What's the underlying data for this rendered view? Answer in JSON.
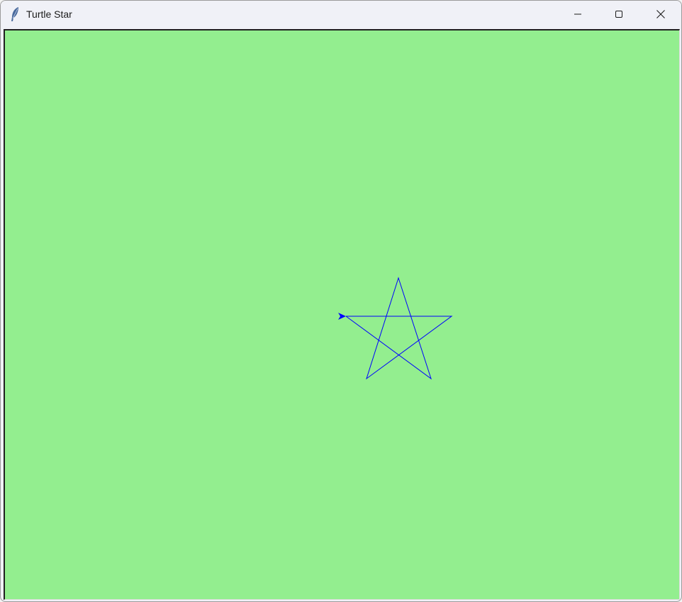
{
  "window": {
    "title": "Turtle Star",
    "app_icon": "feather-icon",
    "controls": [
      "minimize-icon",
      "maximize-icon",
      "close-icon"
    ]
  },
  "canvas": {
    "background_color": "#93ee8f",
    "pen_color": "#0000ff",
    "turtle_color": "#0000ff",
    "shape": "five-pointed-star"
  }
}
